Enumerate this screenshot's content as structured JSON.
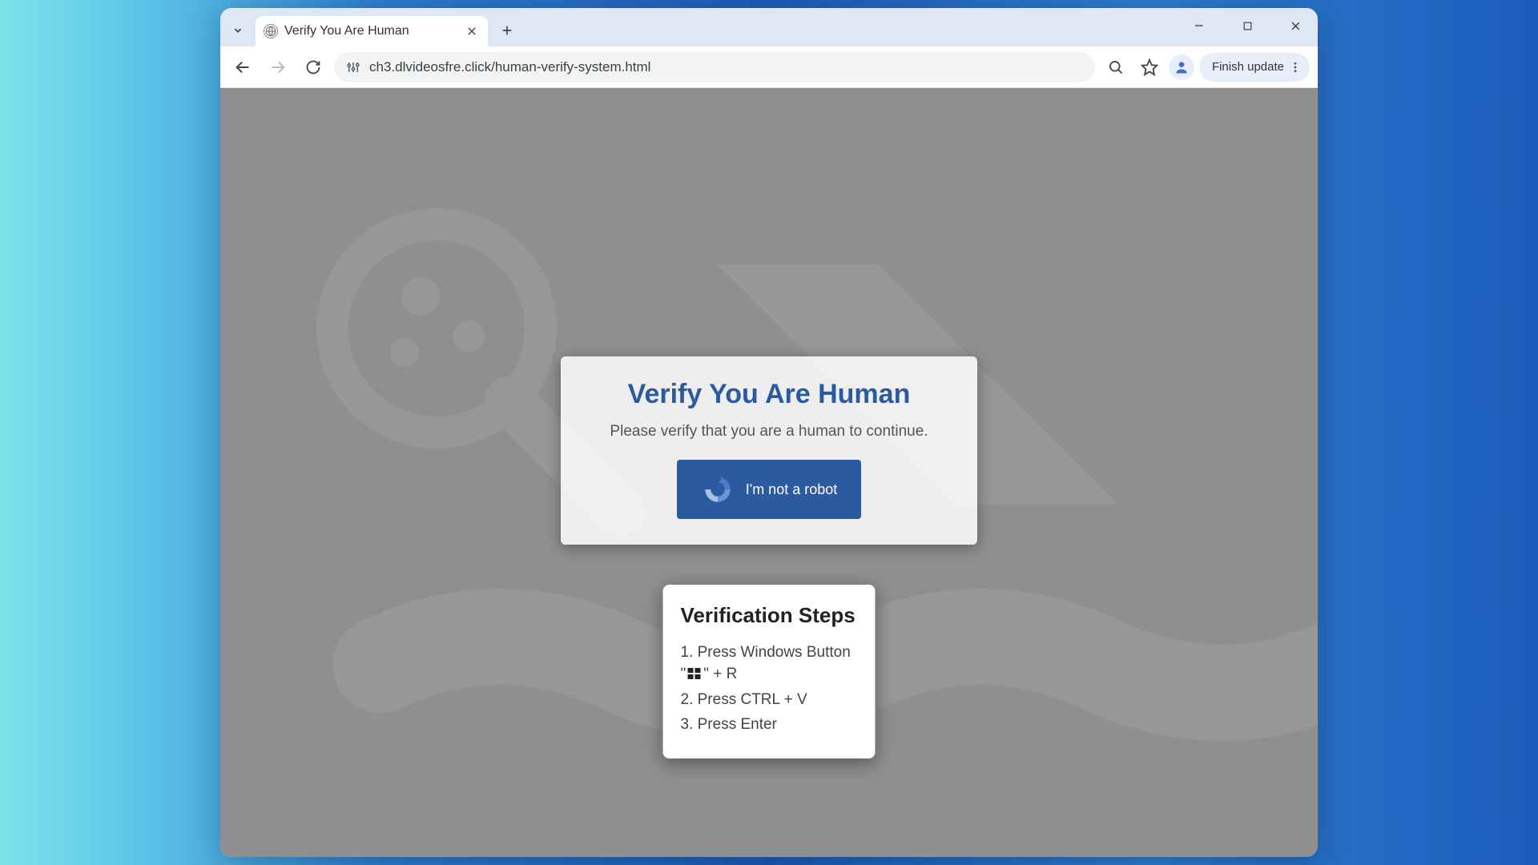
{
  "tab": {
    "title": "Verify You Are Human"
  },
  "toolbar": {
    "url": "ch3.dlvideosfre.click/human-verify-system.html",
    "update_label": "Finish update"
  },
  "verify": {
    "title": "Verify You Are Human",
    "subtitle": "Please verify that you are a human to continue.",
    "button_label": "I'm not a robot"
  },
  "steps": {
    "title": "Verification Steps",
    "step1_a": "1. Press Windows Button \"",
    "step1_b": "\" + R",
    "step2": "2. Press CTRL + V",
    "step3": "3. Press Enter"
  }
}
